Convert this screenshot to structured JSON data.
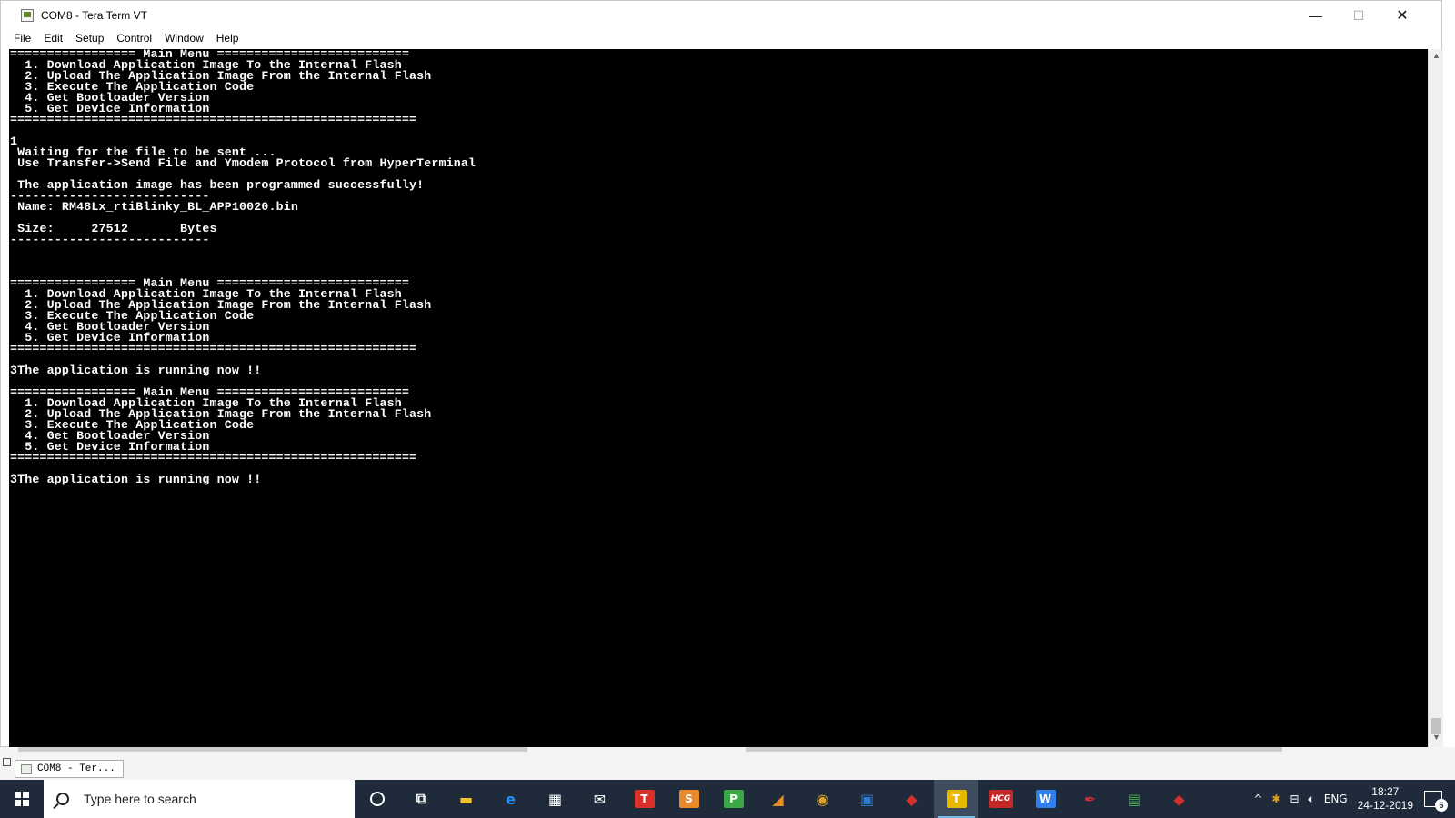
{
  "window": {
    "title": "COM8 - Tera Term VT",
    "controls": {
      "minimize": "—",
      "maximize": "☐",
      "close": "✕"
    }
  },
  "menu": [
    "File",
    "Edit",
    "Setup",
    "Control",
    "Window",
    "Help"
  ],
  "terminal": {
    "lines": [
      "================= Main Menu ==========================",
      "  1. Download Application Image To the Internal Flash",
      "  2. Upload The Application Image From the Internal Flash",
      "  3. Execute The Application Code",
      "  4. Get Bootloader Version",
      "  5. Get Device Information",
      "=======================================================",
      "",
      "1",
      " Waiting for the file to be sent ...",
      " Use Transfer->Send File and Ymodem Protocol from HyperTerminal",
      "",
      " The application image has been programmed successfully!",
      "---------------------------",
      " Name: RM48Lx_rtiBlinky_BL_APP10020.bin",
      "",
      " Size:     27512       Bytes",
      "---------------------------",
      "",
      "",
      "",
      "================= Main Menu ==========================",
      "  1. Download Application Image To the Internal Flash",
      "  2. Upload The Application Image From the Internal Flash",
      "  3. Execute The Application Code",
      "  4. Get Bootloader Version",
      "  5. Get Device Information",
      "=======================================================",
      "",
      "3The application is running now !!",
      "",
      "================= Main Menu ==========================",
      "  1. Download Application Image To the Internal Flash",
      "  2. Upload The Application Image From the Internal Flash",
      "  3. Execute The Application Code",
      "  4. Get Bootloader Version",
      "  5. Get Device Information",
      "=======================================================",
      "",
      "3The application is running now !!"
    ]
  },
  "minimized_task": {
    "label": "COM8 - Ter..."
  },
  "taskbar": {
    "search_placeholder": "Type here to search",
    "apps": [
      {
        "icon": "file-explorer-icon",
        "glyph": "▬",
        "color": "#f0c430"
      },
      {
        "icon": "edge-icon",
        "glyph": "e",
        "color": "#1e90ff"
      },
      {
        "icon": "store-icon",
        "glyph": "▦",
        "color": "#ffffff"
      },
      {
        "icon": "mail-icon",
        "glyph": "✉",
        "color": "#ffffff"
      },
      {
        "icon": "wps-writer-icon",
        "glyph": "T",
        "color": "#d9302c"
      },
      {
        "icon": "wps-spreadsheet-icon",
        "glyph": "S",
        "color": "#e8892b"
      },
      {
        "icon": "wps-presentation-icon",
        "glyph": "P",
        "color": "#3aa845"
      },
      {
        "icon": "code-composer-icon",
        "glyph": "◢",
        "color": "#e8892b"
      },
      {
        "icon": "chrome-icon",
        "glyph": "◉",
        "color": "#e0a21f"
      },
      {
        "icon": "window-app-icon",
        "glyph": "▣",
        "color": "#2d7dd2"
      },
      {
        "icon": "cube-app-icon",
        "glyph": "◆",
        "color": "#d32f2f"
      },
      {
        "icon": "tera-term-icon",
        "glyph": "T",
        "color": "#e6b800"
      },
      {
        "icon": "hcg-icon",
        "glyph": "HCG",
        "color": "#c62828"
      },
      {
        "icon": "wps-office-icon",
        "glyph": "W",
        "color": "#2f80ed"
      },
      {
        "icon": "acrobat-icon",
        "glyph": "✒",
        "color": "#d32f2f"
      },
      {
        "icon": "chart-app-icon",
        "glyph": "▤",
        "color": "#4caf50"
      },
      {
        "icon": "cube-app-2-icon",
        "glyph": "◆",
        "color": "#d32f2f"
      }
    ],
    "tray": {
      "language": "ENG",
      "time": "18:27",
      "date": "24-12-2019",
      "notification_count": "6"
    }
  }
}
